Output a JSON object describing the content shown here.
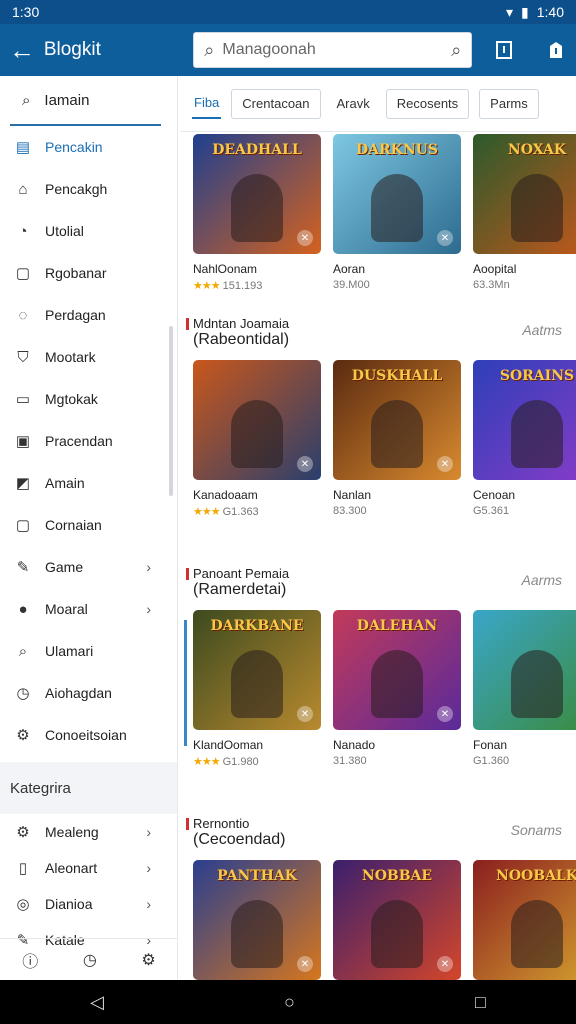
{
  "status": {
    "time": "1:30",
    "right_time": "1:40"
  },
  "appbar": {
    "title": "Blogkit",
    "search_placeholder": "Managoonah"
  },
  "sidebar": {
    "search_label": "Iamain",
    "items": [
      {
        "label": "Pencakin",
        "icon": "grid-icon"
      },
      {
        "label": "Pencakgh",
        "icon": "home-icon"
      },
      {
        "label": "Utolial",
        "icon": "user-icon"
      },
      {
        "label": "Rgobanar",
        "icon": "bag-icon"
      },
      {
        "label": "Perdagan",
        "icon": "person-icon"
      },
      {
        "label": "Mootark",
        "icon": "shield-icon"
      },
      {
        "label": "Mgtokak",
        "icon": "tag-icon"
      },
      {
        "label": "Pracendan",
        "icon": "box-icon"
      },
      {
        "label": "Amain",
        "icon": "chart-icon"
      },
      {
        "label": "Cornaian",
        "icon": "square-icon"
      },
      {
        "label": "Game",
        "icon": "edit-icon"
      },
      {
        "label": "Moaral",
        "icon": "circle-icon"
      },
      {
        "label": "Ulamari",
        "icon": "search-icon"
      },
      {
        "label": "Aiohagdan",
        "icon": "clock-icon"
      },
      {
        "label": "Conoeitsoian",
        "icon": "gear-icon"
      }
    ],
    "section_title": "Kategrira",
    "cat_items": [
      {
        "label": "Mealeng",
        "icon": "gear-icon"
      },
      {
        "label": "Aleonart",
        "icon": "document-icon"
      },
      {
        "label": "Dianioa",
        "icon": "globe-icon"
      },
      {
        "label": "Katale",
        "icon": "edit-icon"
      }
    ]
  },
  "tabs": [
    "Fiba",
    "Crentacoan",
    "Aravk",
    "Recosents",
    "Parms"
  ],
  "sections": [
    {
      "subtitle": "",
      "title": "",
      "link": "",
      "cards": [
        {
          "art": "DEADHALL",
          "title": "NahlOonam",
          "meta": "151.193",
          "stars": "★★★",
          "colors": [
            "#1f3f8f",
            "#d4621e"
          ]
        },
        {
          "art": "DARKNUS",
          "title": "Aoran",
          "meta": "39.M00",
          "stars": "",
          "colors": [
            "#7ec8e3",
            "#2d6b8f"
          ]
        },
        {
          "art": "NOXAK",
          "title": "Aoopital",
          "meta": "63.3Mn",
          "stars": "",
          "colors": [
            "#2b5a2b",
            "#c9571b"
          ]
        }
      ]
    },
    {
      "subtitle": "Mdntan Joamaia",
      "title": "(Rabeontidal)",
      "link": "Aatms",
      "cards": [
        {
          "art": "",
          "title": "Kanadoaam",
          "meta": "G1.363",
          "stars": "★★★",
          "colors": [
            "#c9571b",
            "#2a3f6d"
          ]
        },
        {
          "art": "DUSKHALL",
          "title": "Nanlan",
          "meta": "83.300",
          "stars": "",
          "colors": [
            "#5a2a10",
            "#d98a2f"
          ]
        },
        {
          "art": "SORAINS",
          "title": "Cenoan",
          "meta": "G5.361",
          "stars": "",
          "colors": [
            "#2e3fb8",
            "#8a3cc8"
          ]
        }
      ]
    },
    {
      "subtitle": "Panoant Pemaia",
      "title": "(Ramerdetai)",
      "link": "Aarms",
      "cards": [
        {
          "art": "DARKBANE",
          "title": "KlandOoman",
          "meta": "G1.980",
          "stars": "★★★",
          "colors": [
            "#3c4a1f",
            "#b88a2f"
          ]
        },
        {
          "art": "DALEHAN",
          "title": "Nanado",
          "meta": "31.380",
          "stars": "",
          "colors": [
            "#c23a5a",
            "#5a2a9a"
          ]
        },
        {
          "art": "",
          "title": "Fonan",
          "meta": "G1.360",
          "stars": "",
          "colors": [
            "#3aa6c8",
            "#3a8a3a"
          ]
        }
      ]
    },
    {
      "subtitle": "Rernontio",
      "title": "(Cecoendad)",
      "link": "Sonams",
      "cards": [
        {
          "art": "PANTHAK",
          "title": "",
          "meta": "",
          "stars": "",
          "colors": [
            "#2a3f8f",
            "#d6761e"
          ]
        },
        {
          "art": "NOBBAE",
          "title": "",
          "meta": "",
          "stars": "",
          "colors": [
            "#3a1f6d",
            "#d4462a"
          ]
        },
        {
          "art": "NOOBALK",
          "title": "",
          "meta": "",
          "stars": "",
          "colors": [
            "#8a1f1f",
            "#d6a12f"
          ]
        }
      ]
    }
  ]
}
